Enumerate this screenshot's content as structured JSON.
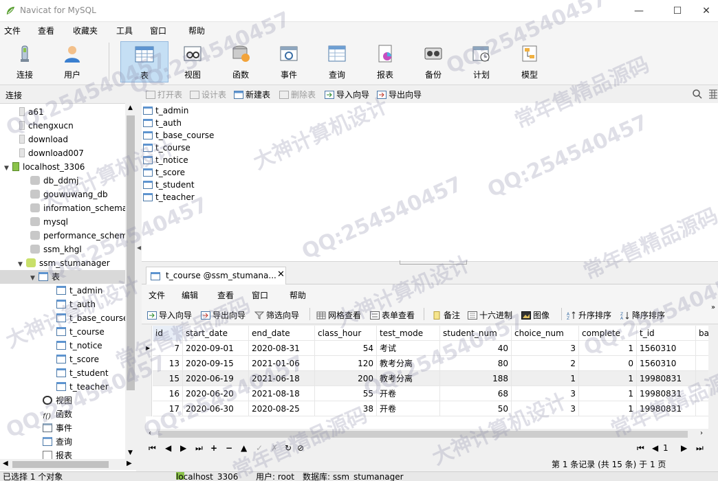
{
  "window": {
    "title": "Navicat for MySQL",
    "controls": [
      "—",
      "☐",
      "✕"
    ]
  },
  "menubar": {
    "items": [
      "文件",
      "查看",
      "收藏夹",
      "工具",
      "窗口",
      "帮助"
    ]
  },
  "toolbar": {
    "items": [
      {
        "label": "连接",
        "icon": "connection-icon"
      },
      {
        "label": "用户",
        "icon": "user-icon"
      },
      {
        "label": "表",
        "icon": "table-icon",
        "active": true
      },
      {
        "label": "视图",
        "icon": "view-icon"
      },
      {
        "label": "函数",
        "icon": "function-icon"
      },
      {
        "label": "事件",
        "icon": "event-icon"
      },
      {
        "label": "查询",
        "icon": "query-icon"
      },
      {
        "label": "报表",
        "icon": "report-icon"
      },
      {
        "label": "备份",
        "icon": "backup-icon"
      },
      {
        "label": "计划",
        "icon": "schedule-icon"
      },
      {
        "label": "模型",
        "icon": "model-icon"
      }
    ]
  },
  "connection_header": "连接",
  "object_toolbar": {
    "open": "打开表",
    "design": "设计表",
    "new": "新建表",
    "delete": "删除表",
    "import": "导入向导",
    "export": "导出向导"
  },
  "nav_tree": {
    "connections_top": [
      "a61",
      "chengxucn",
      "download",
      "download007"
    ],
    "localhost": "localhost_3306",
    "databases": [
      "db_ddmj",
      "gouwuwang_db",
      "information_schema",
      "mysql",
      "performance_schem",
      "ssm_khgl",
      "ssm_stumanager"
    ],
    "tables_node": "表",
    "tables": [
      "t_admin",
      "t_auth",
      "t_base_course",
      "t_course",
      "t_notice",
      "t_score",
      "t_student",
      "t_teacher"
    ],
    "other_nodes": [
      "视图",
      "函数",
      "事件",
      "查询",
      "报表"
    ]
  },
  "object_list": [
    "t_admin",
    "t_auth",
    "t_base_course",
    "t_course",
    "t_notice",
    "t_score",
    "t_student",
    "t_teacher"
  ],
  "tab": {
    "label": "t_course @ssm_stumana...",
    "close": "✕"
  },
  "inner_menu": [
    "文件",
    "编辑",
    "查看",
    "窗口",
    "帮助"
  ],
  "grid_toolbar": {
    "import": "导入向导",
    "export": "导出向导",
    "filter": "筛选向导",
    "grid_view": "网格查看",
    "form_view": "表单查看",
    "memo": "备注",
    "hex": "十六进制",
    "image": "图像",
    "sort_asc": "升序排序",
    "sort_desc": "降序排序"
  },
  "grid": {
    "columns": [
      "id",
      "start_date",
      "end_date",
      "class_hour",
      "test_mode",
      "student_num",
      "choice_num",
      "complete",
      "t_id",
      "ba"
    ],
    "rows": [
      [
        "7",
        "2020-09-01",
        "2020-08-31",
        "54",
        "考试",
        "40",
        "3",
        "1",
        "1560310"
      ],
      [
        "13",
        "2020-09-15",
        "2021-01-06",
        "120",
        "教考分离",
        "80",
        "2",
        "0",
        "1560310"
      ],
      [
        "15",
        "2020-06-19",
        "2021-06-18",
        "200",
        "教考分离",
        "188",
        "1",
        "1",
        "19980831"
      ],
      [
        "16",
        "2020-06-20",
        "2021-08-18",
        "55",
        "开卷",
        "68",
        "3",
        "1",
        "19980831"
      ],
      [
        "17",
        "2020-06-30",
        "2020-08-25",
        "38",
        "开卷",
        "50",
        "3",
        "1",
        "19980831"
      ]
    ],
    "current_row": 0
  },
  "record_nav": {
    "buttons": [
      "⏮",
      "◀",
      "▶",
      "⏭",
      "+",
      "−",
      "▲",
      "✓",
      "✗",
      "↻",
      "⊘"
    ],
    "page": "1"
  },
  "record_status": "第 1 条记录 (共 15 条) 于 1 页",
  "statusbar": {
    "selection": "已选择 1 个对象",
    "connection": "localhost_3306",
    "user": "用户: root",
    "database": "数据库: ssm_stumanager"
  },
  "watermarks": [
    "QQ:254540457",
    "大神计算机设计",
    "常年售精品源码"
  ],
  "colors": {
    "active_tool_bg": "#c5dff4",
    "selection_bg": "#d9d9d9"
  }
}
